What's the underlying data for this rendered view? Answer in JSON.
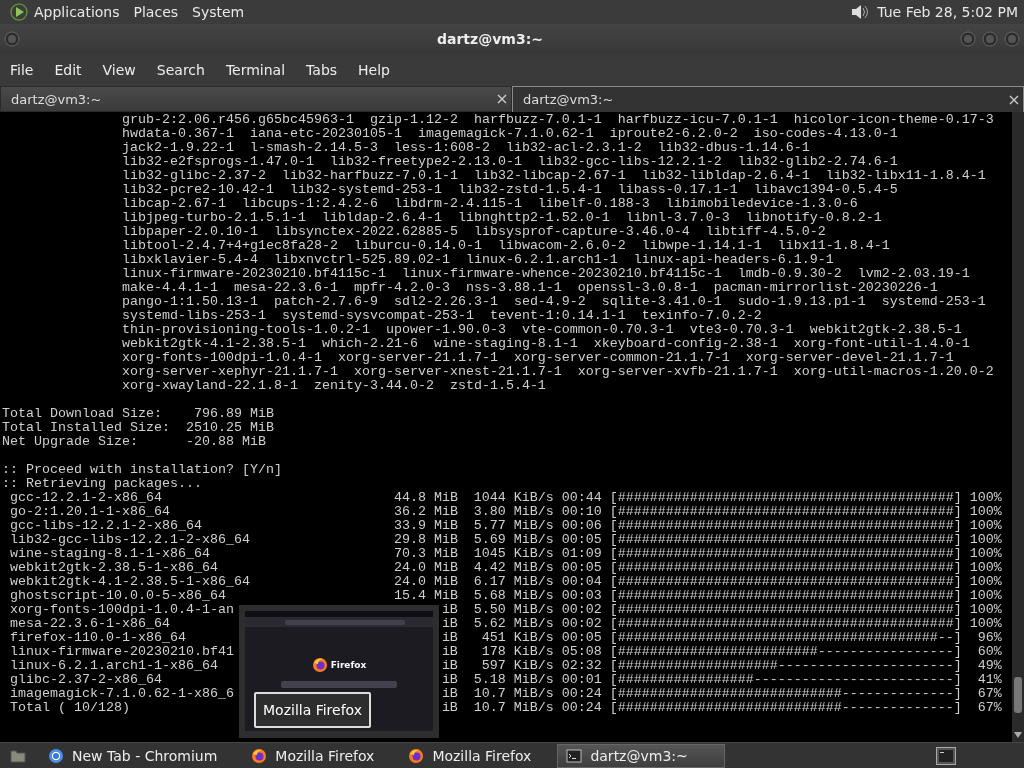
{
  "top_panel": {
    "menus": [
      "Applications",
      "Places",
      "System"
    ],
    "clock": "Tue Feb 28,  5:02 PM"
  },
  "window": {
    "title": "dartz@vm3:~"
  },
  "menu_bar": [
    "File",
    "Edit",
    "View",
    "Search",
    "Terminal",
    "Tabs",
    "Help"
  ],
  "tabs": [
    {
      "label": "dartz@vm3:~",
      "selected": false
    },
    {
      "label": "dartz@vm3:~",
      "selected": true
    }
  ],
  "terminal": {
    "package_lines": [
      "grub-2:2.06.r456.g65bc45963-1  gzip-1.12-2  harfbuzz-7.0.1-1  harfbuzz-icu-7.0.1-1  hicolor-icon-theme-0.17-3",
      "hwdata-0.367-1  iana-etc-20230105-1  imagemagick-7.1.0.62-1  iproute2-6.2.0-2  iso-codes-4.13.0-1",
      "jack2-1.9.22-1  l-smash-2.14.5-3  less-1:608-2  lib32-acl-2.3.1-2  lib32-dbus-1.14.6-1",
      "lib32-e2fsprogs-1.47.0-1  lib32-freetype2-2.13.0-1  lib32-gcc-libs-12.2.1-2  lib32-glib2-2.74.6-1",
      "lib32-glibc-2.37-2  lib32-harfbuzz-7.0.1-1  lib32-libcap-2.67-1  lib32-libldap-2.6.4-1  lib32-libx11-1.8.4-1",
      "lib32-pcre2-10.42-1  lib32-systemd-253-1  lib32-zstd-1.5.4-1  libass-0.17.1-1  libavc1394-0.5.4-5",
      "libcap-2.67-1  libcups-1:2.4.2-6  libdrm-2.4.115-1  libelf-0.188-3  libimobiledevice-1.3.0-6",
      "libjpeg-turbo-2.1.5.1-1  libldap-2.6.4-1  libnghttp2-1.52.0-1  libnl-3.7.0-3  libnotify-0.8.2-1",
      "libpaper-2.0.10-1  libsynctex-2022.62885-5  libsysprof-capture-3.46.0-4  libtiff-4.5.0-2",
      "libtool-2.4.7+4+g1ec8fa28-2  liburcu-0.14.0-1  libwacom-2.6.0-2  libwpe-1.14.1-1  libx11-1.8.4-1",
      "libxklavier-5.4-4  libxnvctrl-525.89.02-1  linux-6.2.1.arch1-1  linux-api-headers-6.1.9-1",
      "linux-firmware-20230210.bf4115c-1  linux-firmware-whence-20230210.bf4115c-1  lmdb-0.9.30-2  lvm2-2.03.19-1",
      "make-4.4.1-1  mesa-22.3.6-1  mpfr-4.2.0-3  nss-3.88.1-1  openssl-3.0.8-1  pacman-mirrorlist-20230226-1",
      "pango-1:1.50.13-1  patch-2.7.6-9  sdl2-2.26.3-1  sed-4.9-2  sqlite-3.41.0-1  sudo-1.9.13.p1-1  systemd-253-1",
      "systemd-libs-253-1  systemd-sysvcompat-253-1  tevent-1:0.14.1-1  texinfo-7.0.2-2",
      "thin-provisioning-tools-1.0.2-1  upower-1.90.0-3  vte-common-0.70.3-1  vte3-0.70.3-1  webkit2gtk-2.38.5-1",
      "webkit2gtk-4.1-2.38.5-1  which-2.21-6  wine-staging-8.1-1  xkeyboard-config-2.38-1  xorg-font-util-1.4.0-1",
      "xorg-fonts-100dpi-1.0.4-1  xorg-server-21.1.7-1  xorg-server-common-21.1.7-1  xorg-server-devel-21.1.7-1",
      "xorg-server-xephyr-21.1.7-1  xorg-server-xnest-21.1.7-1  xorg-server-xvfb-21.1.7-1  xorg-util-macros-1.20.0-2",
      "xorg-xwayland-22.1.8-1  zenity-3.44.0-2  zstd-1.5.4-1"
    ],
    "summary_lines": [
      "Total Download Size:    796.89 MiB",
      "Total Installed Size:  2510.25 MiB",
      "Net Upgrade Size:      -20.88 MiB"
    ],
    "prompt_lines": [
      ":: Proceed with installation? [Y/n]",
      ":: Retrieving packages..."
    ],
    "downloads": [
      {
        "name": "gcc-12.2.1-2-x86_64",
        "size": "44.8 MiB",
        "speed": "1044 KiB/s",
        "time": "00:44",
        "bar": "[##########################################]",
        "percent": "100%"
      },
      {
        "name": "go-2:1.20.1-1-x86_64",
        "size": "36.2 MiB",
        "speed": "3.80 MiB/s",
        "time": "00:10",
        "bar": "[##########################################]",
        "percent": "100%"
      },
      {
        "name": "gcc-libs-12.2.1-2-x86_64",
        "size": "33.9 MiB",
        "speed": "5.77 MiB/s",
        "time": "00:06",
        "bar": "[##########################################]",
        "percent": "100%"
      },
      {
        "name": "lib32-gcc-libs-12.2.1-2-x86_64",
        "size": "29.8 MiB",
        "speed": "5.69 MiB/s",
        "time": "00:05",
        "bar": "[##########################################]",
        "percent": "100%"
      },
      {
        "name": "wine-staging-8.1-1-x86_64",
        "size": "70.3 MiB",
        "speed": "1045 KiB/s",
        "time": "01:09",
        "bar": "[##########################################]",
        "percent": "100%"
      },
      {
        "name": "webkit2gtk-2.38.5-1-x86_64",
        "size": "24.0 MiB",
        "speed": "4.42 MiB/s",
        "time": "00:05",
        "bar": "[##########################################]",
        "percent": "100%"
      },
      {
        "name": "webkit2gtk-4.1-2.38.5-1-x86_64",
        "size": "24.0 MiB",
        "speed": "6.17 MiB/s",
        "time": "00:04",
        "bar": "[##########################################]",
        "percent": "100%"
      },
      {
        "name": "ghostscript-10.0.0-5-x86_64",
        "size": "15.4 MiB",
        "speed": "5.68 MiB/s",
        "time": "00:03",
        "bar": "[##########################################]",
        "percent": "100%"
      },
      {
        "name": "xorg-fonts-100dpi-1.0.4-1-an",
        "size": "iB",
        "speed": "5.50 MiB/s",
        "time": "00:02",
        "bar": "[##########################################]",
        "percent": "100%"
      },
      {
        "name": "mesa-22.3.6-1-x86_64",
        "size": "iB",
        "speed": "5.62 MiB/s",
        "time": "00:02",
        "bar": "[##########################################]",
        "percent": "100%"
      },
      {
        "name": "firefox-110.0-1-x86_64",
        "size": "iB",
        "speed": "451 KiB/s",
        "time": "00:05",
        "bar": "[########################################--]",
        "percent": "96%"
      },
      {
        "name": "linux-firmware-20230210.bf41",
        "size": "iB",
        "speed": "178 KiB/s",
        "time": "05:08",
        "bar": "[#########################-----------------]",
        "percent": "60%"
      },
      {
        "name": "linux-6.2.1.arch1-1-x86_64",
        "size": "iB",
        "speed": "597 KiB/s",
        "time": "02:32",
        "bar": "[####################----------------------]",
        "percent": "49%"
      },
      {
        "name": "glibc-2.37-2-x86_64",
        "size": "iB",
        "speed": "5.18 MiB/s",
        "time": "00:01",
        "bar": "[#################-------------------------]",
        "percent": "41%"
      },
      {
        "name": "imagemagick-7.1.0.62-1-x86_6",
        "size": "iB",
        "speed": "10.7 MiB/s",
        "time": "00:24",
        "bar": "[############################--------------]",
        "percent": "67%"
      },
      {
        "name": "Total ( 10/128)",
        "size": "iB",
        "speed": "10.7 MiB/s",
        "time": "00:24",
        "bar": "[############################--------------]",
        "percent": "67%"
      }
    ]
  },
  "preview": {
    "page_heading": "Firefox",
    "title": "Mozilla Firefox"
  },
  "taskbar": [
    {
      "kind": "chromium",
      "label": "New Tab - Chromium",
      "selected": false
    },
    {
      "kind": "firefox",
      "label": "Mozilla Firefox",
      "selected": false
    },
    {
      "kind": "firefox",
      "label": "Mozilla Firefox",
      "selected": false
    },
    {
      "kind": "terminal",
      "label": "dartz@vm3:~",
      "selected": true
    }
  ]
}
